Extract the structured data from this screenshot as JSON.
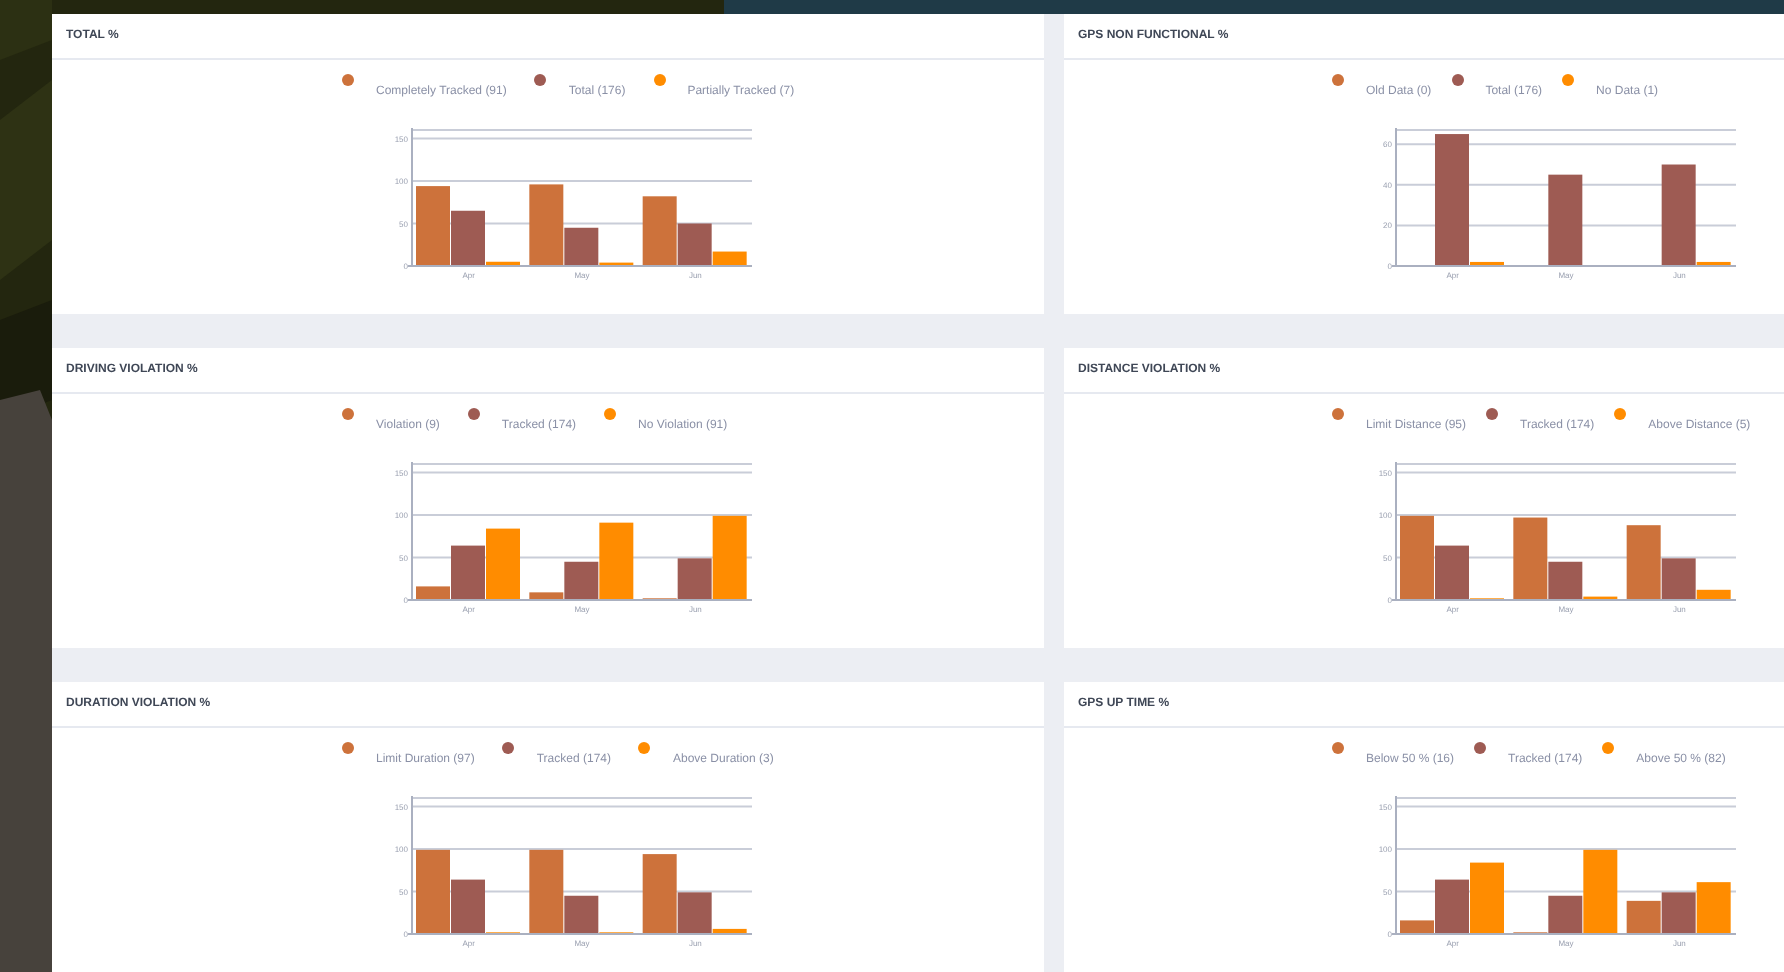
{
  "cards": [
    {
      "title": "TOTAL %",
      "chart_data": {
        "type": "bar",
        "grid": true,
        "categories": [
          "Apr",
          "May",
          "Jun"
        ],
        "ylim": [
          0,
          160
        ],
        "yticks": [
          0,
          50,
          100,
          150
        ],
        "series": [
          {
            "name": "Completely Tracked (91)",
            "color": "#cd723b",
            "values": [
              94,
              96,
              82
            ]
          },
          {
            "name": "Total (176)",
            "color": "#9e5b53",
            "values": [
              65,
              45,
              50
            ]
          },
          {
            "name": "Partially Tracked (7)",
            "color": "#ff8c00",
            "values": [
              5,
              4,
              17
            ]
          }
        ]
      }
    },
    {
      "title": "GPS NON FUNCTIONAL %",
      "chart_data": {
        "type": "bar",
        "grid": true,
        "categories": [
          "Apr",
          "May",
          "Jun"
        ],
        "ylim": [
          0,
          67
        ],
        "yticks": [
          0,
          20,
          40,
          60
        ],
        "series": [
          {
            "name": "Old Data (0)",
            "color": "#cd723b",
            "values": [
              0,
              0,
              0
            ]
          },
          {
            "name": "Total (176)",
            "color": "#9e5b53",
            "values": [
              65,
              45,
              50
            ]
          },
          {
            "name": "No Data (1)",
            "color": "#ff8c00",
            "values": [
              2,
              0,
              2
            ]
          }
        ]
      }
    },
    {
      "title": "DRIVING VIOLATION %",
      "chart_data": {
        "type": "bar",
        "grid": true,
        "categories": [
          "Apr",
          "May",
          "Jun"
        ],
        "ylim": [
          0,
          160
        ],
        "yticks": [
          0,
          50,
          100,
          150
        ],
        "series": [
          {
            "name": "Violation (9)",
            "color": "#cd723b",
            "values": [
              16,
              9,
              2
            ]
          },
          {
            "name": "Tracked (174)",
            "color": "#9e5b53",
            "values": [
              64,
              45,
              49
            ]
          },
          {
            "name": "No Violation (91)",
            "color": "#ff8c00",
            "values": [
              84,
              91,
              99
            ]
          }
        ]
      }
    },
    {
      "title": "DISTANCE VIOLATION %",
      "chart_data": {
        "type": "bar",
        "grid": true,
        "categories": [
          "Apr",
          "May",
          "Jun"
        ],
        "ylim": [
          0,
          160
        ],
        "yticks": [
          0,
          50,
          100,
          150
        ],
        "series": [
          {
            "name": "Limit Distance (95)",
            "color": "#cd723b",
            "values": [
              99,
              97,
              88
            ]
          },
          {
            "name": "Tracked (174)",
            "color": "#9e5b53",
            "values": [
              64,
              45,
              49
            ]
          },
          {
            "name": "Above Distance (5)",
            "color": "#ff8c00",
            "values": [
              2,
              4,
              12
            ]
          }
        ]
      }
    },
    {
      "title": "DURATION VIOLATION %",
      "chart_data": {
        "type": "bar",
        "grid": true,
        "categories": [
          "Apr",
          "May",
          "Jun"
        ],
        "ylim": [
          0,
          160
        ],
        "yticks": [
          0,
          50,
          100,
          150
        ],
        "series": [
          {
            "name": "Limit Duration (97)",
            "color": "#cd723b",
            "values": [
              99,
              99,
              94
            ]
          },
          {
            "name": "Tracked (174)",
            "color": "#9e5b53",
            "values": [
              64,
              45,
              49
            ]
          },
          {
            "name": "Above Duration (3)",
            "color": "#ff8c00",
            "values": [
              2,
              2,
              6
            ]
          }
        ]
      }
    },
    {
      "title": "GPS UP TIME %",
      "chart_data": {
        "type": "bar",
        "grid": true,
        "categories": [
          "Apr",
          "May",
          "Jun"
        ],
        "ylim": [
          0,
          160
        ],
        "yticks": [
          0,
          50,
          100,
          150
        ],
        "series": [
          {
            "name": "Below 50 % (16)",
            "color": "#cd723b",
            "values": [
              16,
              2,
              39
            ]
          },
          {
            "name": "Tracked (174)",
            "color": "#9e5b53",
            "values": [
              64,
              45,
              49
            ]
          },
          {
            "name": "Above 50 % (82)",
            "color": "#ff8c00",
            "values": [
              84,
              99,
              61
            ]
          }
        ]
      }
    }
  ]
}
